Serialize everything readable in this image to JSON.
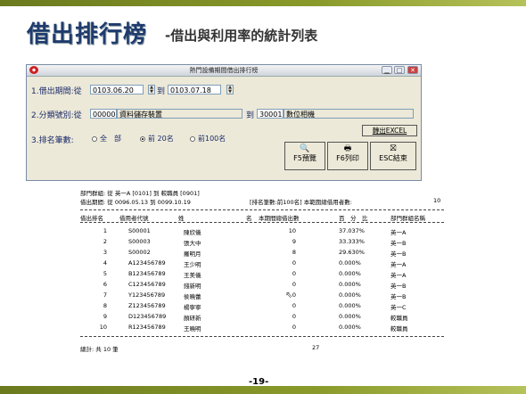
{
  "slide": {
    "title": "借出排行榜",
    "subtitle": "-借出與利用率的統計列表",
    "page_number": "-19-"
  },
  "dialog": {
    "title": "熱門設備期間借出排行榜",
    "period_label": "1.借出期間:從",
    "period_from": "0103.06.20",
    "period_to_label": "到",
    "period_to": "0103.07.18",
    "category_label": "2.分類號別:從",
    "category_from_code": "00000",
    "category_from_name": "資料儲存裝置",
    "category_to_label": "到",
    "category_to_code": "30001",
    "category_to_name": "數位相機",
    "rank_label": "3.排名筆數:",
    "rank_options": [
      "全　部",
      "前 20名",
      "前100名"
    ],
    "rank_selected": "前 20名",
    "export_label": "轉出EXCEL",
    "preview_label": "F5預覽",
    "print_label": "F6列印",
    "exit_label": "ESC結束"
  },
  "report": {
    "dept_line": "部門群組: 從 英一A [0101] 到 較職員 [0901]",
    "period_line": "借出期間: 從 0096.05.13 到 0099.10.19",
    "rank_info": "[排名筆數:前100名] 本範圍總借用者數:",
    "total_users": "10",
    "columns": [
      "借出排名",
      "借用者代號",
      "姓",
      "名",
      "本期間總借出數",
      "百　分　比",
      "部門群組名稱"
    ],
    "rows": [
      {
        "rank": "1",
        "id": "S00001",
        "name": "陳欣儀",
        "count": "10",
        "pct": "37.037%",
        "dept": "英一A"
      },
      {
        "rank": "2",
        "id": "S00003",
        "name": "張大中",
        "count": "9",
        "pct": "33.333%",
        "dept": "英一B"
      },
      {
        "rank": "3",
        "id": "S00002",
        "name": "羅明月",
        "count": "8",
        "pct": "29.630%",
        "dept": "英一B"
      },
      {
        "rank": "4",
        "id": "A123456789",
        "name": "王少明",
        "count": "0",
        "pct": "0.000%",
        "dept": "英一A"
      },
      {
        "rank": "5",
        "id": "B123456789",
        "name": "王美儀",
        "count": "0",
        "pct": "0.000%",
        "dept": "英一A"
      },
      {
        "rank": "6",
        "id": "C123456789",
        "name": "錢新明",
        "count": "0",
        "pct": "0.000%",
        "dept": "英一B"
      },
      {
        "rank": "7",
        "id": "Y123456789",
        "name": "侯曉蕾",
        "count": "0",
        "pct": "0.000%",
        "dept": "英一B"
      },
      {
        "rank": "8",
        "id": "Z123456789",
        "name": "楊寧寧",
        "count": "0",
        "pct": "0.000%",
        "dept": "英一C"
      },
      {
        "rank": "9",
        "id": "D123456789",
        "name": "顏研新",
        "count": "0",
        "pct": "0.000%",
        "dept": "較職員"
      },
      {
        "rank": "10",
        "id": "R123456789",
        "name": "王曉明",
        "count": "0",
        "pct": "0.000%",
        "dept": "較職員"
      }
    ],
    "total_label": "總計: 共 10 筆",
    "total_count": "27"
  }
}
